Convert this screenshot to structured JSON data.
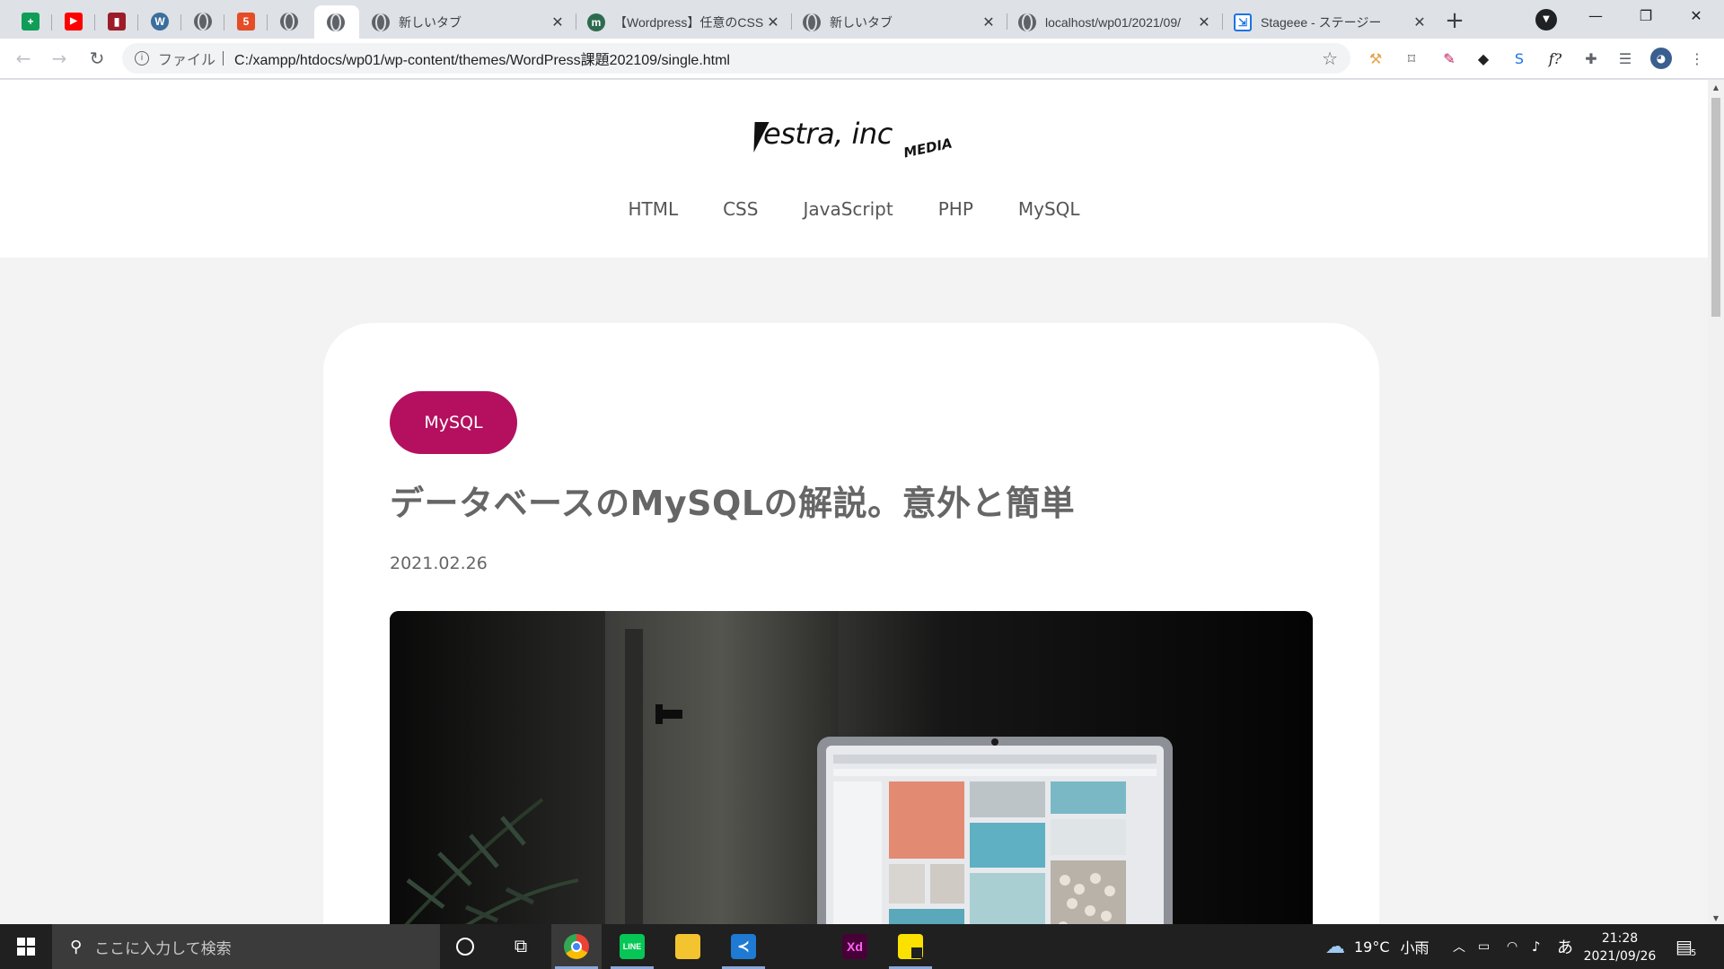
{
  "browser": {
    "pinned_tabs": [
      {
        "icon": "google-sheets-icon",
        "color": "#0f9d58",
        "glyph": "+"
      },
      {
        "icon": "youtube-icon",
        "color": "#ff0000",
        "glyph": "▶"
      },
      {
        "icon": "book-app-icon",
        "color": "#9c1c2a",
        "glyph": "▮"
      },
      {
        "icon": "wordpress-icon",
        "color": "#3c6e9c",
        "glyph": "W"
      },
      {
        "icon": "globe-icon",
        "color": "#5f6368",
        "glyph": ""
      },
      {
        "icon": "html5-icon",
        "color": "#e44d26",
        "glyph": "5"
      },
      {
        "icon": "globe-icon",
        "color": "#5f6368",
        "glyph": ""
      }
    ],
    "tabs": [
      {
        "title": "",
        "icon": "globe-icon",
        "active": true
      },
      {
        "title": "新しいタブ",
        "icon": "chrome-icon",
        "active": false
      },
      {
        "title": "【Wordpress】任意のCSSフ",
        "icon": "m-site-icon",
        "active": false
      },
      {
        "title": "新しいタブ",
        "icon": "chrome-icon",
        "active": false
      },
      {
        "title": "localhost/wp01/2021/09/",
        "icon": "globe-icon",
        "active": false
      },
      {
        "title": "Stageee - ステージー",
        "icon": "stageee-icon",
        "active": false
      }
    ],
    "address": {
      "scheme_label": "ファイル",
      "url": "C:/xampp/htdocs/wp01/wp-content/themes/WordPress課題202109/single.html"
    }
  },
  "site": {
    "logo_main": "estra, inc",
    "logo_sub": "MEDIA",
    "nav": [
      "HTML",
      "CSS",
      "JavaScript",
      "PHP",
      "MySQL"
    ]
  },
  "post": {
    "category": "MySQL",
    "category_color": "#b4105f",
    "title": "データベースのMySQLの解説。意外と簡単",
    "date": "2021.02.26"
  },
  "taskbar": {
    "search_placeholder": "ここに入力して検索",
    "weather_temp": "19°C",
    "weather_text": "小雨",
    "ime": "あ",
    "time": "21:28",
    "date": "2021/09/26",
    "notification_count": "5",
    "apps": [
      "cortana-icon",
      "task-view-icon",
      "chrome-icon",
      "line-icon",
      "file-explorer-icon",
      "vscode-icon",
      "adobe-xd-icon",
      "sticky-notes-icon"
    ]
  }
}
